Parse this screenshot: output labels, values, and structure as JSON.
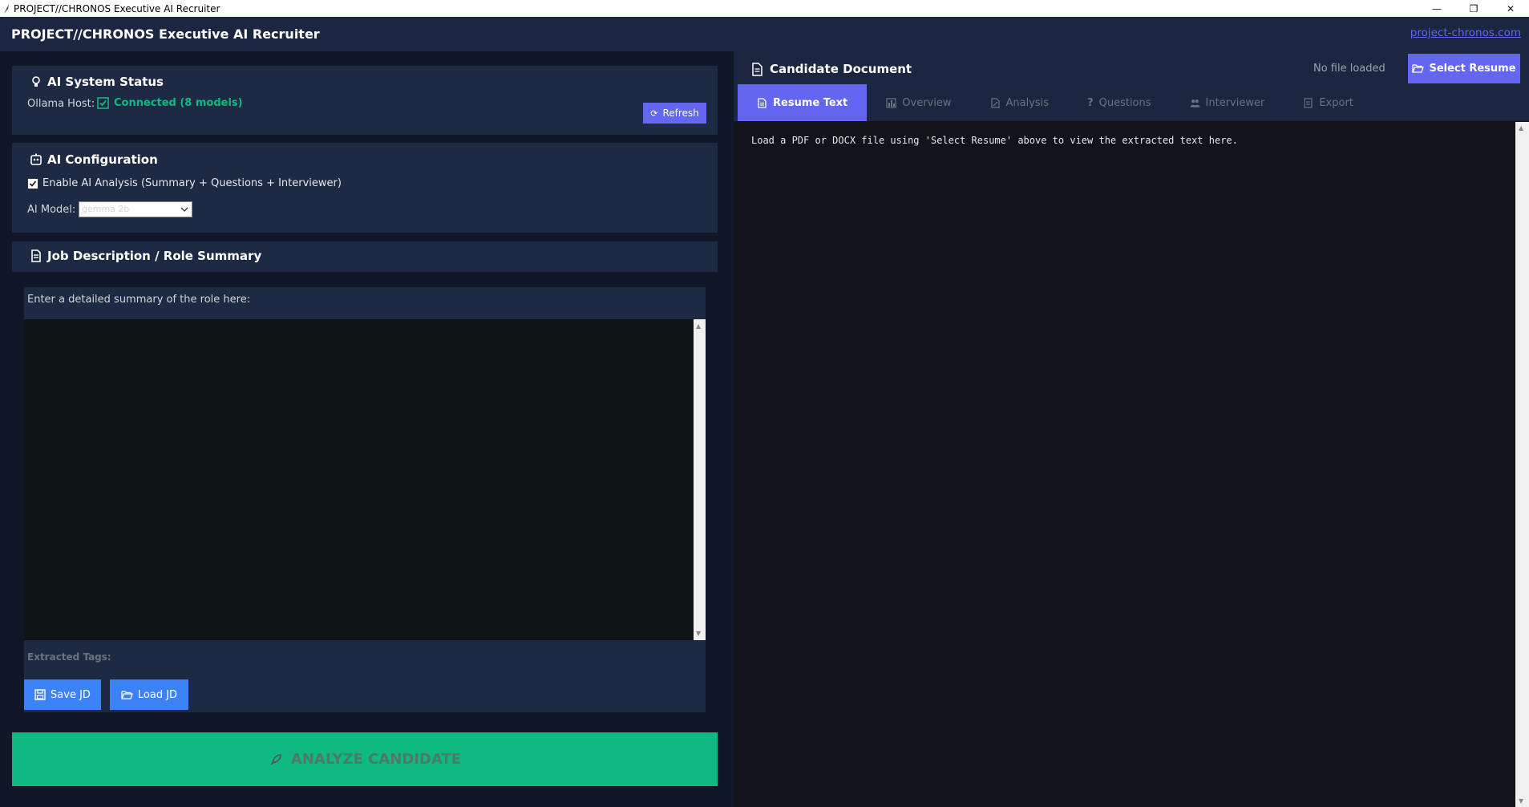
{
  "window": {
    "title": "PROJECT//CHRONOS Executive AI Recruiter",
    "minimize": "—",
    "restore": "❐",
    "close": "✕"
  },
  "header": {
    "title": "PROJECT//CHRONOS Executive AI Recruiter",
    "link": "project-chronos.com"
  },
  "status_panel": {
    "title": "AI System Status",
    "host_label": "Ollama Host:",
    "status_text": "Connected (8 models)",
    "refresh_label": "Refresh"
  },
  "config_panel": {
    "title": "AI Configuration",
    "enable_label": "Enable AI Analysis (Summary + Questions + Interviewer)",
    "enable_checked": true,
    "model_label": "AI Model:",
    "model_value": "gemma 2b"
  },
  "jd_panel": {
    "title": "Job Description / Role Summary",
    "prompt": "Enter a detailed summary of the role here:",
    "textarea_value": "",
    "tags_label": "Extracted Tags:",
    "save_label": "Save JD",
    "load_label": "Load JD"
  },
  "analyze_button": "ANALYZE CANDIDATE",
  "document": {
    "title": "Candidate Document",
    "file_status": "No file loaded",
    "select_label": "Select Resume",
    "tabs": [
      {
        "label": "Resume Text",
        "icon": "document-icon"
      },
      {
        "label": "Overview",
        "icon": "bar-chart-icon"
      },
      {
        "label": "Analysis",
        "icon": "pencil-doc-icon"
      },
      {
        "label": "Questions",
        "icon": "question-icon"
      },
      {
        "label": "Interviewer",
        "icon": "people-icon"
      },
      {
        "label": "Export",
        "icon": "export-icon"
      }
    ],
    "active_tab": 0,
    "body_text": "Load a PDF or DOCX file using 'Select Resume' above to view the extracted text here."
  },
  "colors": {
    "background": "#111827",
    "panel": "#1e2a44",
    "accent": "#6366f1",
    "button_blue": "#3b82f6",
    "success": "#10b981",
    "analyze": "#10b981"
  }
}
